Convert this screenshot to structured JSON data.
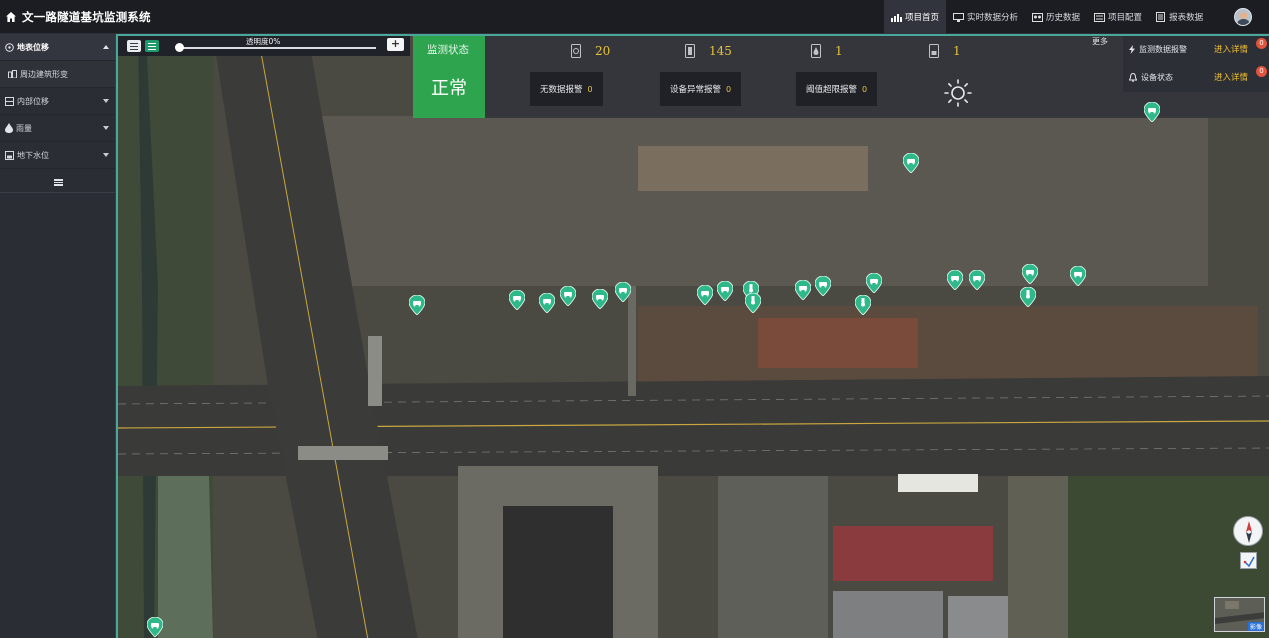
{
  "app": {
    "title": "文一路隧道基坑监测系统"
  },
  "nav": [
    {
      "label": "项目首页",
      "icon": "chart-icon",
      "active": true
    },
    {
      "label": "实时数据分析",
      "icon": "monitor-icon",
      "active": false
    },
    {
      "label": "历史数据",
      "icon": "history-icon",
      "active": false
    },
    {
      "label": "项目配置",
      "icon": "config-icon",
      "active": false
    },
    {
      "label": "报表数据",
      "icon": "report-icon",
      "active": false
    }
  ],
  "sidebar": {
    "items": [
      {
        "label": "地表位移",
        "icon": "target-icon",
        "expanded": true
      },
      {
        "label": "周边建筑形变",
        "icon": "building-icon",
        "sub": true
      },
      {
        "label": "内部位移",
        "icon": "layers-icon",
        "expanded": false
      },
      {
        "label": "雨量",
        "icon": "drop-icon",
        "expanded": false
      },
      {
        "label": "地下水位",
        "icon": "water-level-icon",
        "expanded": false
      }
    ]
  },
  "opacity": {
    "label": "透明度0%",
    "value": 0,
    "plus": "+"
  },
  "status": {
    "caption": "监测状态",
    "value": "正常",
    "stats": [
      {
        "icon": "target-icon",
        "value": "20"
      },
      {
        "icon": "building-icon",
        "value": "145"
      },
      {
        "icon": "drop-icon",
        "value": "1"
      },
      {
        "icon": "water-level-icon",
        "value": "1"
      }
    ],
    "alarms": [
      {
        "label": "无数据报警",
        "count": "0"
      },
      {
        "label": "设备异常报警",
        "count": "0"
      },
      {
        "label": "阈值超限报警",
        "count": "0"
      }
    ],
    "weather_icon": "sun-icon",
    "more": "更多"
  },
  "panels": [
    {
      "label": "监测数据报警",
      "action": "进入详情",
      "badge": "0",
      "icon": "lightning-icon"
    },
    {
      "label": "设备状态",
      "action": "进入详情",
      "badge": "0",
      "icon": "bell-icon"
    }
  ],
  "map": {
    "minimap_tag": "影像"
  },
  "colors": {
    "accent": "#2ea44f",
    "highlight": "#e8c33a",
    "badge": "#e0533c",
    "marker": "#2fb88a"
  }
}
